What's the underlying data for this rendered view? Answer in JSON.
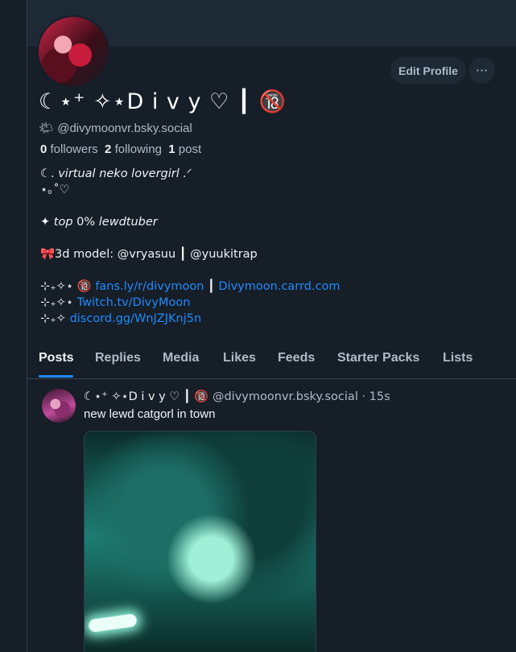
{
  "profile": {
    "display_name": "☾⋆⁺ ✧⋆D i v y ♡ ┃ 🔞",
    "handle_prefix": "🌤",
    "handle": "@divymoonvr.bsky.social",
    "followers_count": "0",
    "followers_label": "followers",
    "following_count": "2",
    "following_label": "following",
    "posts_count": "1",
    "posts_label": "post"
  },
  "actions": {
    "edit_profile": "Edit Profile",
    "more": "···"
  },
  "bio": {
    "line1_prefix": "☾. ",
    "line1_text": "virtual neko lovergirl .ᐟ",
    "line2": "⋆｡˚♡",
    "line3_prefix": "✦ ",
    "line3_italic1": "top",
    "line3_mid": " 0% ",
    "line3_italic2": "lewdtuber",
    "line4": "🎀3d model: @vryasuu ┃ @yuukitrap",
    "line5_prefix": "⊹₊✧⋆ 🔞 ",
    "line5_link1": "fans.ly/r/divymoon",
    "line5_sep": " ┃",
    "line5_link2": "Divymoon.carrd.com",
    "line6_prefix": "⊹₊✧⋆ ",
    "line6_link": "Twitch.tv/DivyMoon",
    "line7_prefix": "⊹₊✧ ",
    "line7_link": "discord.gg/WnJZJKnj5n"
  },
  "tabs": [
    {
      "label": "Posts",
      "active": true
    },
    {
      "label": "Replies"
    },
    {
      "label": "Media"
    },
    {
      "label": "Likes"
    },
    {
      "label": "Feeds"
    },
    {
      "label": "Starter Packs"
    },
    {
      "label": "Lists"
    }
  ],
  "post": {
    "author": "☾⋆⁺ ✧⋆D i v y ♡ ┃ 🔞",
    "handle": "@divymoonvr.bsky.social",
    "time": "· 15s",
    "text": "new lewd catgorl in town"
  },
  "colors": {
    "background": "#161e27",
    "link": "#208bfe",
    "muted": "#aebbc9"
  }
}
